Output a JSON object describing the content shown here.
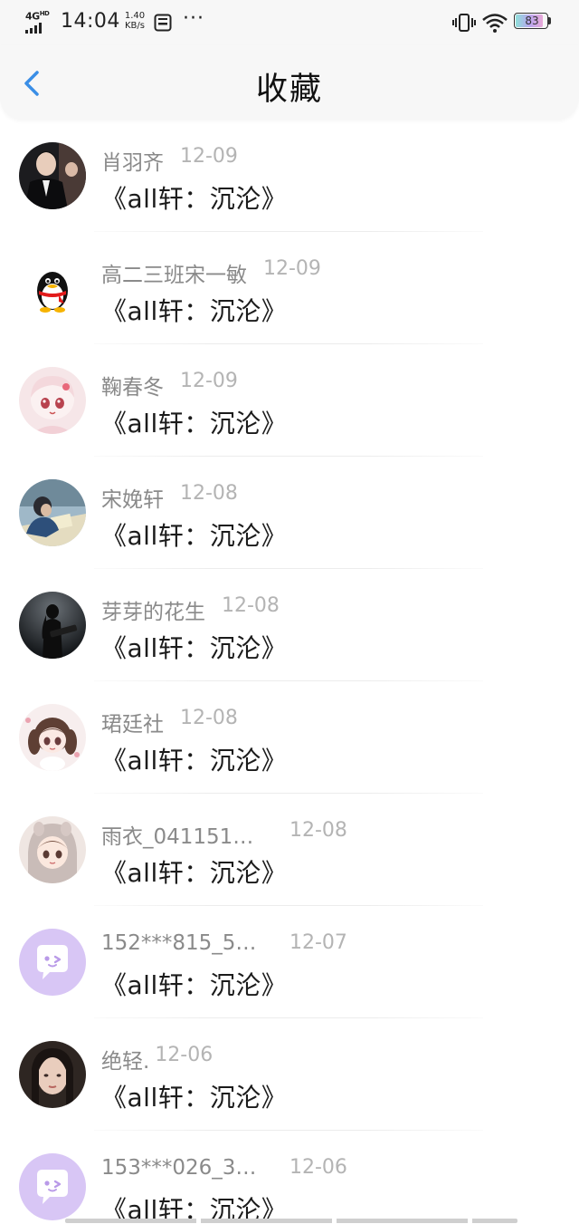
{
  "status_bar": {
    "network": "4G",
    "network_sup": "HD",
    "time": "14:04",
    "speed_value": "1.40",
    "speed_unit": "KB/s",
    "more": "···",
    "battery": "83",
    "battery_level": 0.83,
    "icons": [
      "signal-icon",
      "sd-card-icon",
      "vibrate-icon",
      "wifi-icon",
      "battery-icon"
    ]
  },
  "header": {
    "back_icon": "chevron-left-icon",
    "back_color": "#3a8ee6",
    "title": "收藏"
  },
  "favorites": [
    {
      "name": "肖羽齐",
      "date": "12-09",
      "title": "《all轩：沉沦》",
      "avatar": "photo-man-suit"
    },
    {
      "name": "高二三班宋一敏",
      "date": "12-09",
      "title": "《all轩：沉沦》",
      "avatar": "qq-penguin"
    },
    {
      "name": "鞠春冬",
      "date": "12-09",
      "title": "《all轩：沉沦》",
      "avatar": "anime-girl-pink"
    },
    {
      "name": "宋娩轩",
      "date": "12-08",
      "title": "《all轩：沉沦》",
      "avatar": "photo-boy-desk"
    },
    {
      "name": "芽芽的花生",
      "date": "12-08",
      "title": "《all轩：沉沦》",
      "avatar": "photo-guitar-silhouette"
    },
    {
      "name": "珺廷社",
      "date": "12-08",
      "title": "《all轩：沉沦》",
      "avatar": "anime-girl-twintails"
    },
    {
      "name": "雨衣_041151…",
      "date": "12-08",
      "title": "《all轩：沉沦》",
      "avatar": "anime-girl-hood"
    },
    {
      "name": "152***815_5…",
      "date": "12-07",
      "title": "《all轩：沉沦》",
      "avatar": "default-chat-bubble"
    },
    {
      "name": "绝轻.",
      "date": "12-06",
      "title": "《all轩：沉沦》",
      "avatar": "photo-girl-face"
    },
    {
      "name": "153***026_3…",
      "date": "12-06",
      "title": "《all轩：沉沦》",
      "avatar": "default-chat-bubble"
    }
  ],
  "colors": {
    "accent": "#3a8ee6",
    "default_avatar_bg": "#d8c6f5",
    "name_text": "#8a8a8a",
    "date_text": "#b4b4b4"
  }
}
